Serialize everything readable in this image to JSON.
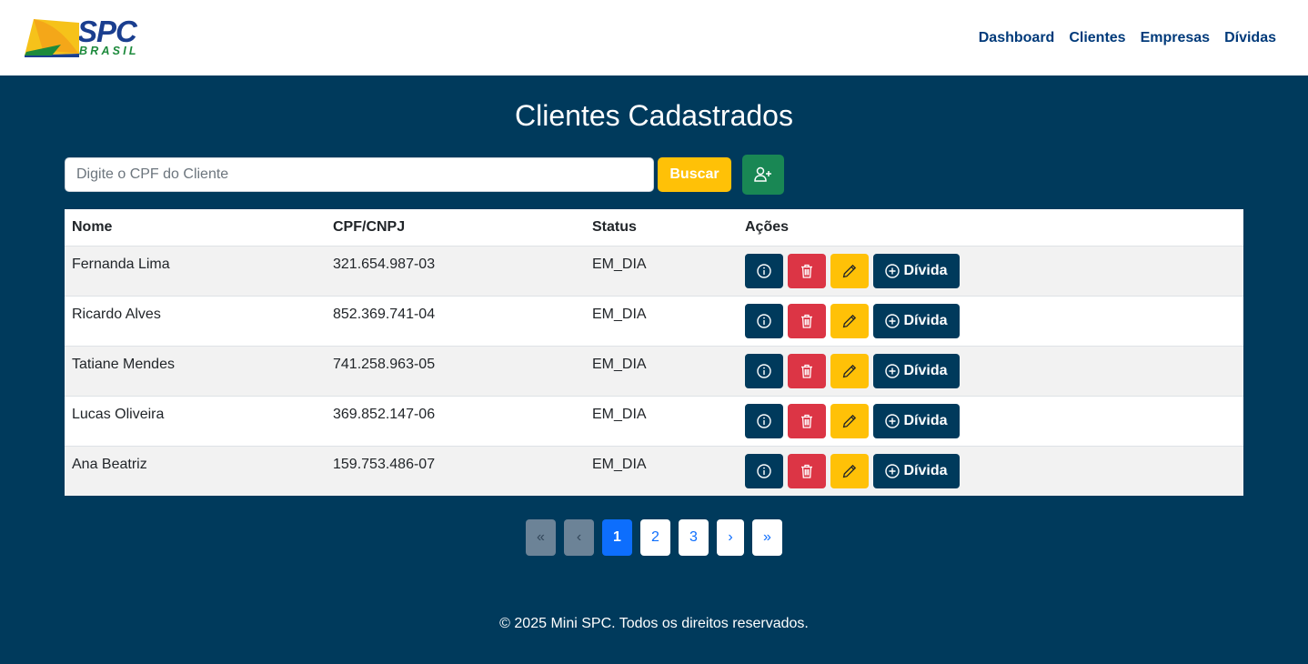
{
  "brand": {
    "name": "SPC",
    "subtitle": "BRASIL"
  },
  "nav": {
    "items": [
      "Dashboard",
      "Clientes",
      "Empresas",
      "Dívidas"
    ]
  },
  "page": {
    "title": "Clientes Cadastrados"
  },
  "search": {
    "placeholder": "Digite o CPF do Cliente",
    "value": "",
    "button_label": "Buscar",
    "add_icon": "user-plus-icon"
  },
  "table": {
    "headers": [
      "Nome",
      "CPF/CNPJ",
      "Status",
      "Ações"
    ],
    "rows": [
      {
        "nome": "Fernanda Lima",
        "cpf": "321.654.987-03",
        "status": "EM_DIA"
      },
      {
        "nome": "Ricardo Alves",
        "cpf": "852.369.741-04",
        "status": "EM_DIA"
      },
      {
        "nome": "Tatiane Mendes",
        "cpf": "741.258.963-05",
        "status": "EM_DIA"
      },
      {
        "nome": "Lucas Oliveira",
        "cpf": "369.852.147-06",
        "status": "EM_DIA"
      },
      {
        "nome": "Ana Beatriz",
        "cpf": "159.753.486-07",
        "status": "EM_DIA"
      }
    ],
    "actions": {
      "divida_label": "Dívida",
      "icons": [
        "info-icon",
        "trash-icon",
        "pencil-icon",
        "plus-circle-icon"
      ]
    }
  },
  "pagination": {
    "first": "«",
    "prev": "‹",
    "pages": [
      "1",
      "2",
      "3"
    ],
    "current": "1",
    "next": "›",
    "last": "»"
  },
  "footer": {
    "text": "© 2025 Mini SPC. Todos os direitos reservados."
  },
  "colors": {
    "primary": "#003a5c",
    "warning": "#ffc107",
    "danger": "#dc3545",
    "success": "#198754",
    "link": "#0d6efd",
    "nav": "#003a7a"
  }
}
